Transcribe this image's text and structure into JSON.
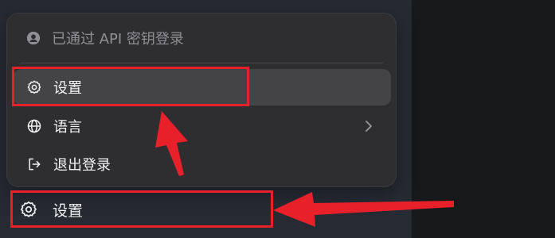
{
  "menu": {
    "header": {
      "label": "已通过 API 密钥登录",
      "icon": "user-circle-icon"
    },
    "items": [
      {
        "label": "设置",
        "icon": "gear-icon",
        "active": true
      },
      {
        "label": "语言",
        "icon": "globe-icon",
        "has_submenu": true
      },
      {
        "label": "退出登录",
        "icon": "logout-icon"
      }
    ]
  },
  "sidebar_bottom": {
    "label": "设置",
    "icon": "gear-icon"
  },
  "annotation": {
    "highlight_color": "#e8202a"
  },
  "colors": {
    "menu_bg": "#2e2e31",
    "active_bg": "#444447",
    "text": "#f2f2f2",
    "muted": "#8f8f95"
  }
}
